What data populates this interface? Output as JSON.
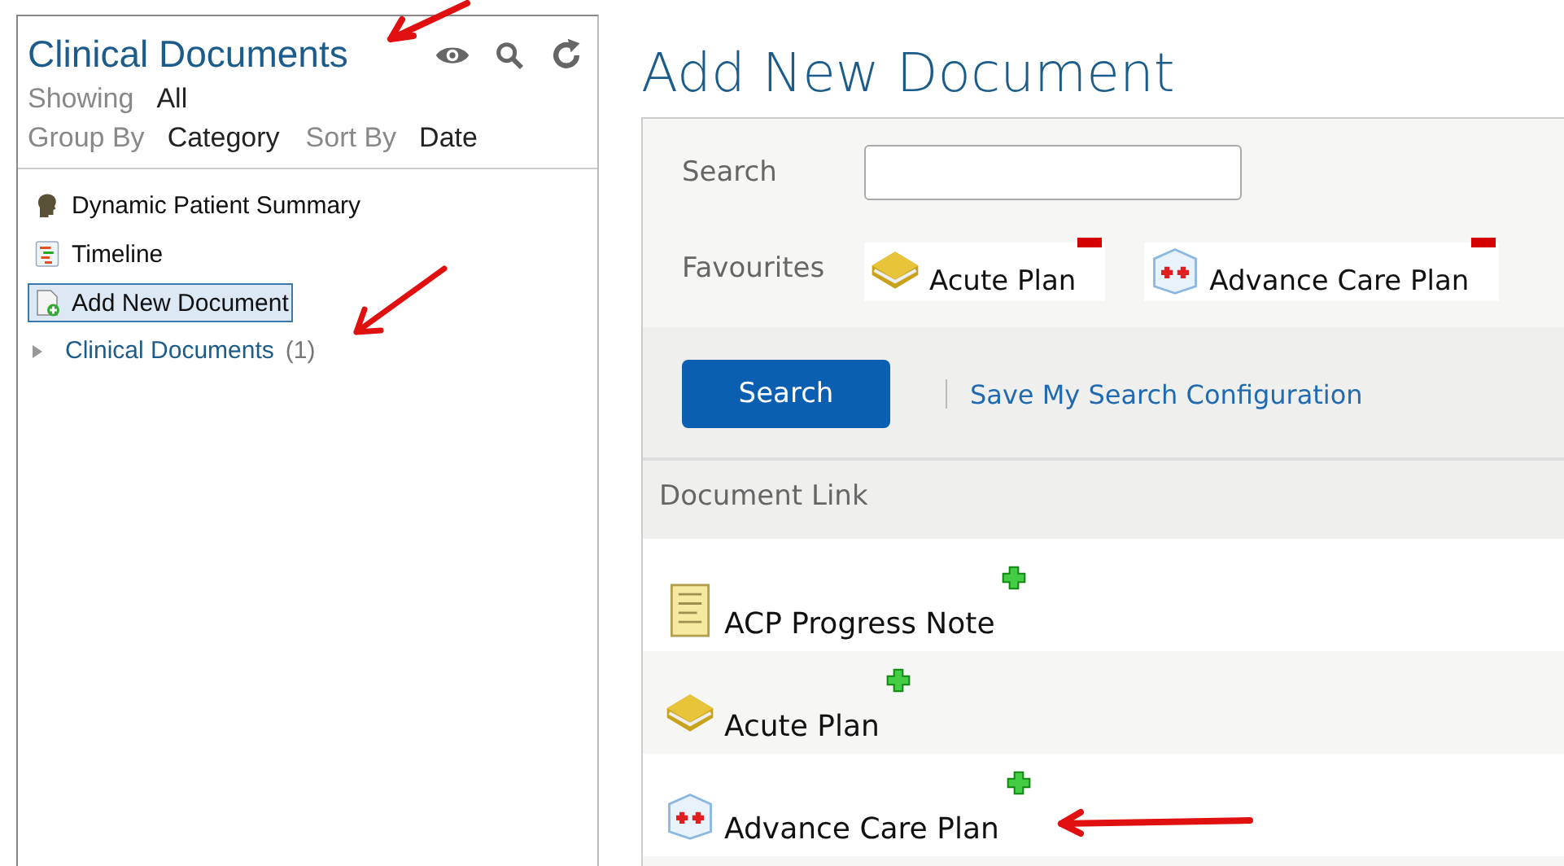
{
  "sidebar": {
    "title": "Clinical Documents",
    "filters": [
      {
        "label": "Showing",
        "value": "All"
      },
      {
        "label": "Group By",
        "value": "Category"
      },
      {
        "label": "Sort By",
        "value": "Date"
      }
    ],
    "items": [
      {
        "kind": "summary",
        "label": "Dynamic Patient Summary",
        "selected": false
      },
      {
        "kind": "timeline",
        "label": "Timeline",
        "selected": false
      },
      {
        "kind": "add",
        "label": "Add New Document",
        "selected": true
      },
      {
        "kind": "folder",
        "label": "Clinical Documents",
        "count": "(1)",
        "expanded": false,
        "selected": false
      }
    ]
  },
  "main": {
    "title": "Add New Document",
    "search": {
      "label": "Search"
    },
    "favourites": {
      "label": "Favourites",
      "items": [
        {
          "kind": "book",
          "label": "Acute Plan"
        },
        {
          "kind": "kit",
          "label": "Advance Care Plan"
        }
      ]
    },
    "search_button": "Search",
    "save_link": "Save My Search Configuration",
    "table": {
      "column": "Document Link",
      "rows": [
        {
          "kind": "note",
          "label": "ACP Progress Note"
        },
        {
          "kind": "book",
          "label": "Acute Plan"
        },
        {
          "kind": "kit",
          "label": "Advance Care Plan"
        }
      ]
    }
  }
}
